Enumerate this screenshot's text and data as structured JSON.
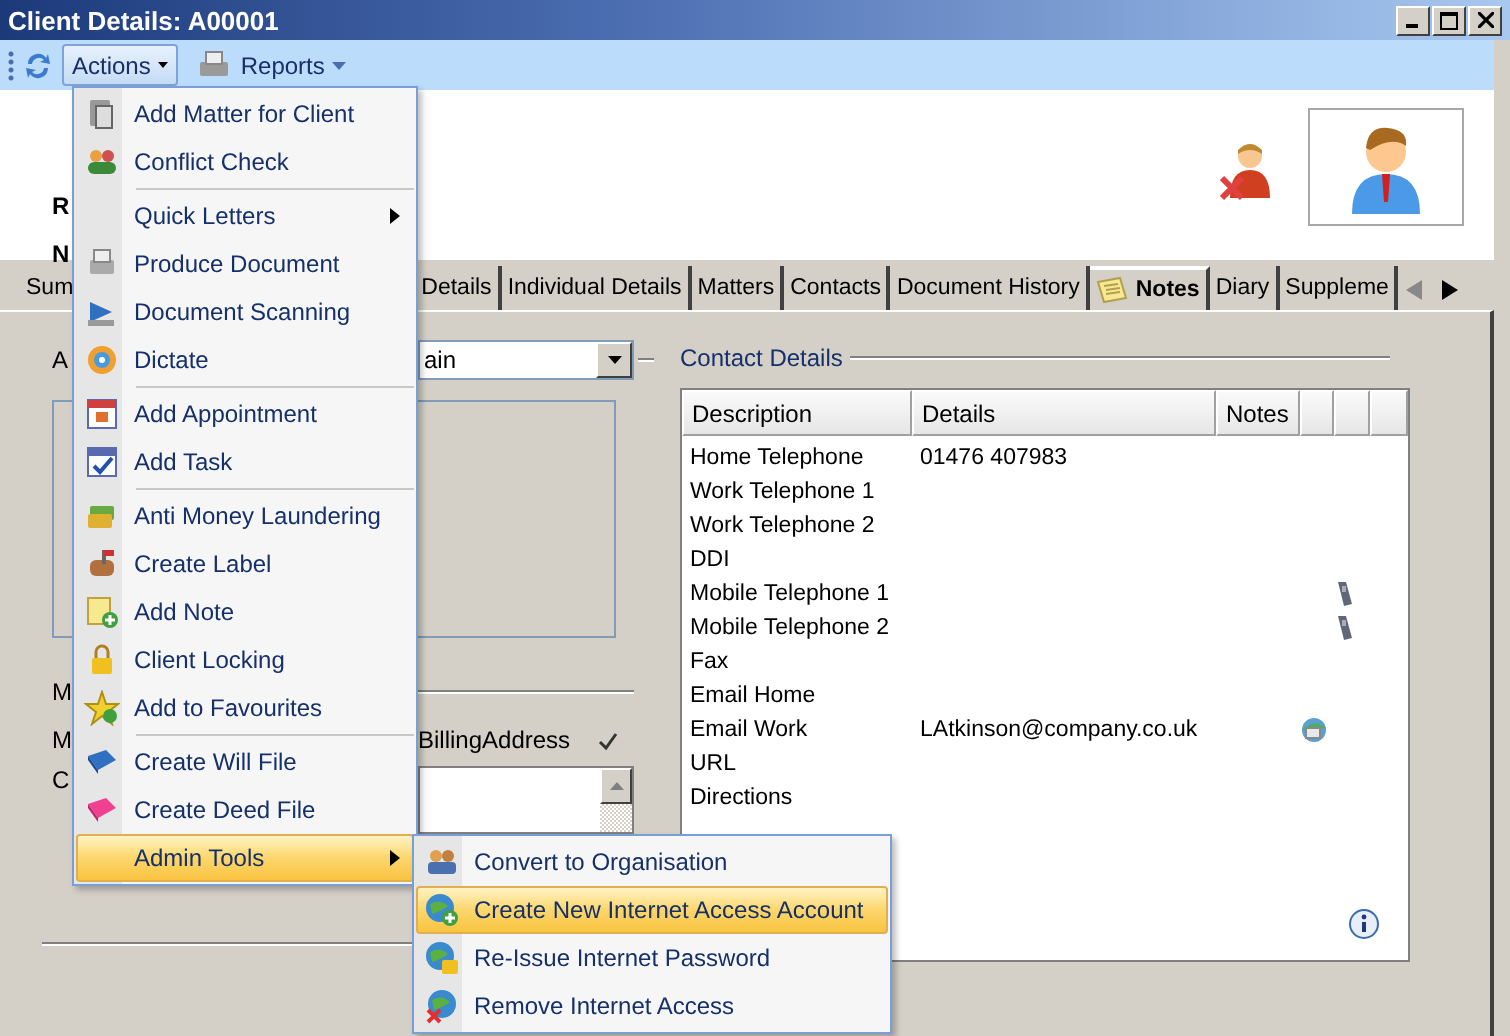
{
  "window": {
    "title": "Client Details: A00001"
  },
  "toolbar": {
    "actions": {
      "label": "Actions",
      "open": true
    },
    "reports": {
      "label": "Reports"
    }
  },
  "header": {
    "labels": [
      "R",
      "N"
    ]
  },
  "tabs": [
    {
      "label": "Sum",
      "selected": false
    },
    {
      "label": "Details",
      "selected": false
    },
    {
      "label": "Individual Details",
      "selected": false
    },
    {
      "label": "Matters",
      "selected": false
    },
    {
      "label": "Contacts",
      "selected": false
    },
    {
      "label": "Document History",
      "selected": false
    },
    {
      "label": "Notes",
      "selected": true,
      "kind": "notes"
    },
    {
      "label": "Diary",
      "selected": false
    },
    {
      "label": "Suppleme",
      "selected": false
    }
  ],
  "left_panel": {
    "labels": [
      "A",
      "M",
      "M",
      "C"
    ],
    "combo_value": "ain",
    "billing_label": "BillingAddress",
    "billing_checked": true
  },
  "contact_details": {
    "title": "Contact Details",
    "columns": [
      "Description",
      "Details",
      "Notes"
    ],
    "rows": [
      {
        "description": "Home Telephone",
        "details": "01476 407983",
        "kind": "plain"
      },
      {
        "description": "Work Telephone 1",
        "kind": "plain"
      },
      {
        "description": "Work Telephone 2",
        "kind": "plain"
      },
      {
        "description": "DDI",
        "kind": "plain"
      },
      {
        "description": "Mobile Telephone 1",
        "kind": "phone"
      },
      {
        "description": "Mobile Telephone 2",
        "kind": "phone"
      },
      {
        "description": "Fax",
        "kind": "plain"
      },
      {
        "description": "Email Home",
        "kind": "plain"
      },
      {
        "description": "Email Work",
        "details": "LAtkinson@company.co.uk",
        "kind": "email"
      },
      {
        "description": "URL",
        "kind": "plain"
      },
      {
        "description": "Directions",
        "kind": "plain"
      }
    ]
  },
  "actions_menu": {
    "items": [
      {
        "kind": "item",
        "label": "Add Matter for Client",
        "selected": false
      },
      {
        "kind": "item",
        "label": "Conflict Check",
        "selected": false
      },
      {
        "kind": "separator"
      },
      {
        "kind": "submenu",
        "label": "Quick Letters",
        "selected": false
      },
      {
        "kind": "item",
        "label": "Produce Document",
        "selected": false
      },
      {
        "kind": "item",
        "label": "Document Scanning",
        "selected": false
      },
      {
        "kind": "item",
        "label": "Dictate",
        "selected": false
      },
      {
        "kind": "separator"
      },
      {
        "kind": "item",
        "label": "Add Appointment",
        "selected": false
      },
      {
        "kind": "item",
        "label": "Add Task",
        "selected": false
      },
      {
        "kind": "separator"
      },
      {
        "kind": "item",
        "label": "Anti Money Laundering",
        "selected": false
      },
      {
        "kind": "item",
        "label": "Create Label",
        "selected": false
      },
      {
        "kind": "item",
        "label": "Add Note",
        "selected": false
      },
      {
        "kind": "item",
        "label": "Client Locking",
        "selected": false
      },
      {
        "kind": "item",
        "label": "Add to Favourites",
        "selected": false
      },
      {
        "kind": "separator"
      },
      {
        "kind": "item",
        "label": "Create Will File",
        "selected": false
      },
      {
        "kind": "item",
        "label": "Create Deed File",
        "selected": false
      },
      {
        "kind": "submenu",
        "label": "Admin Tools",
        "selected": true
      }
    ]
  },
  "admin_menu": {
    "items": [
      {
        "label": "Convert to Organisation",
        "selected": false
      },
      {
        "label": "Create New Internet Access Account",
        "selected": true
      },
      {
        "label": "Re-Issue Internet Password",
        "selected": false
      },
      {
        "label": "Remove Internet Access",
        "selected": false
      }
    ]
  }
}
